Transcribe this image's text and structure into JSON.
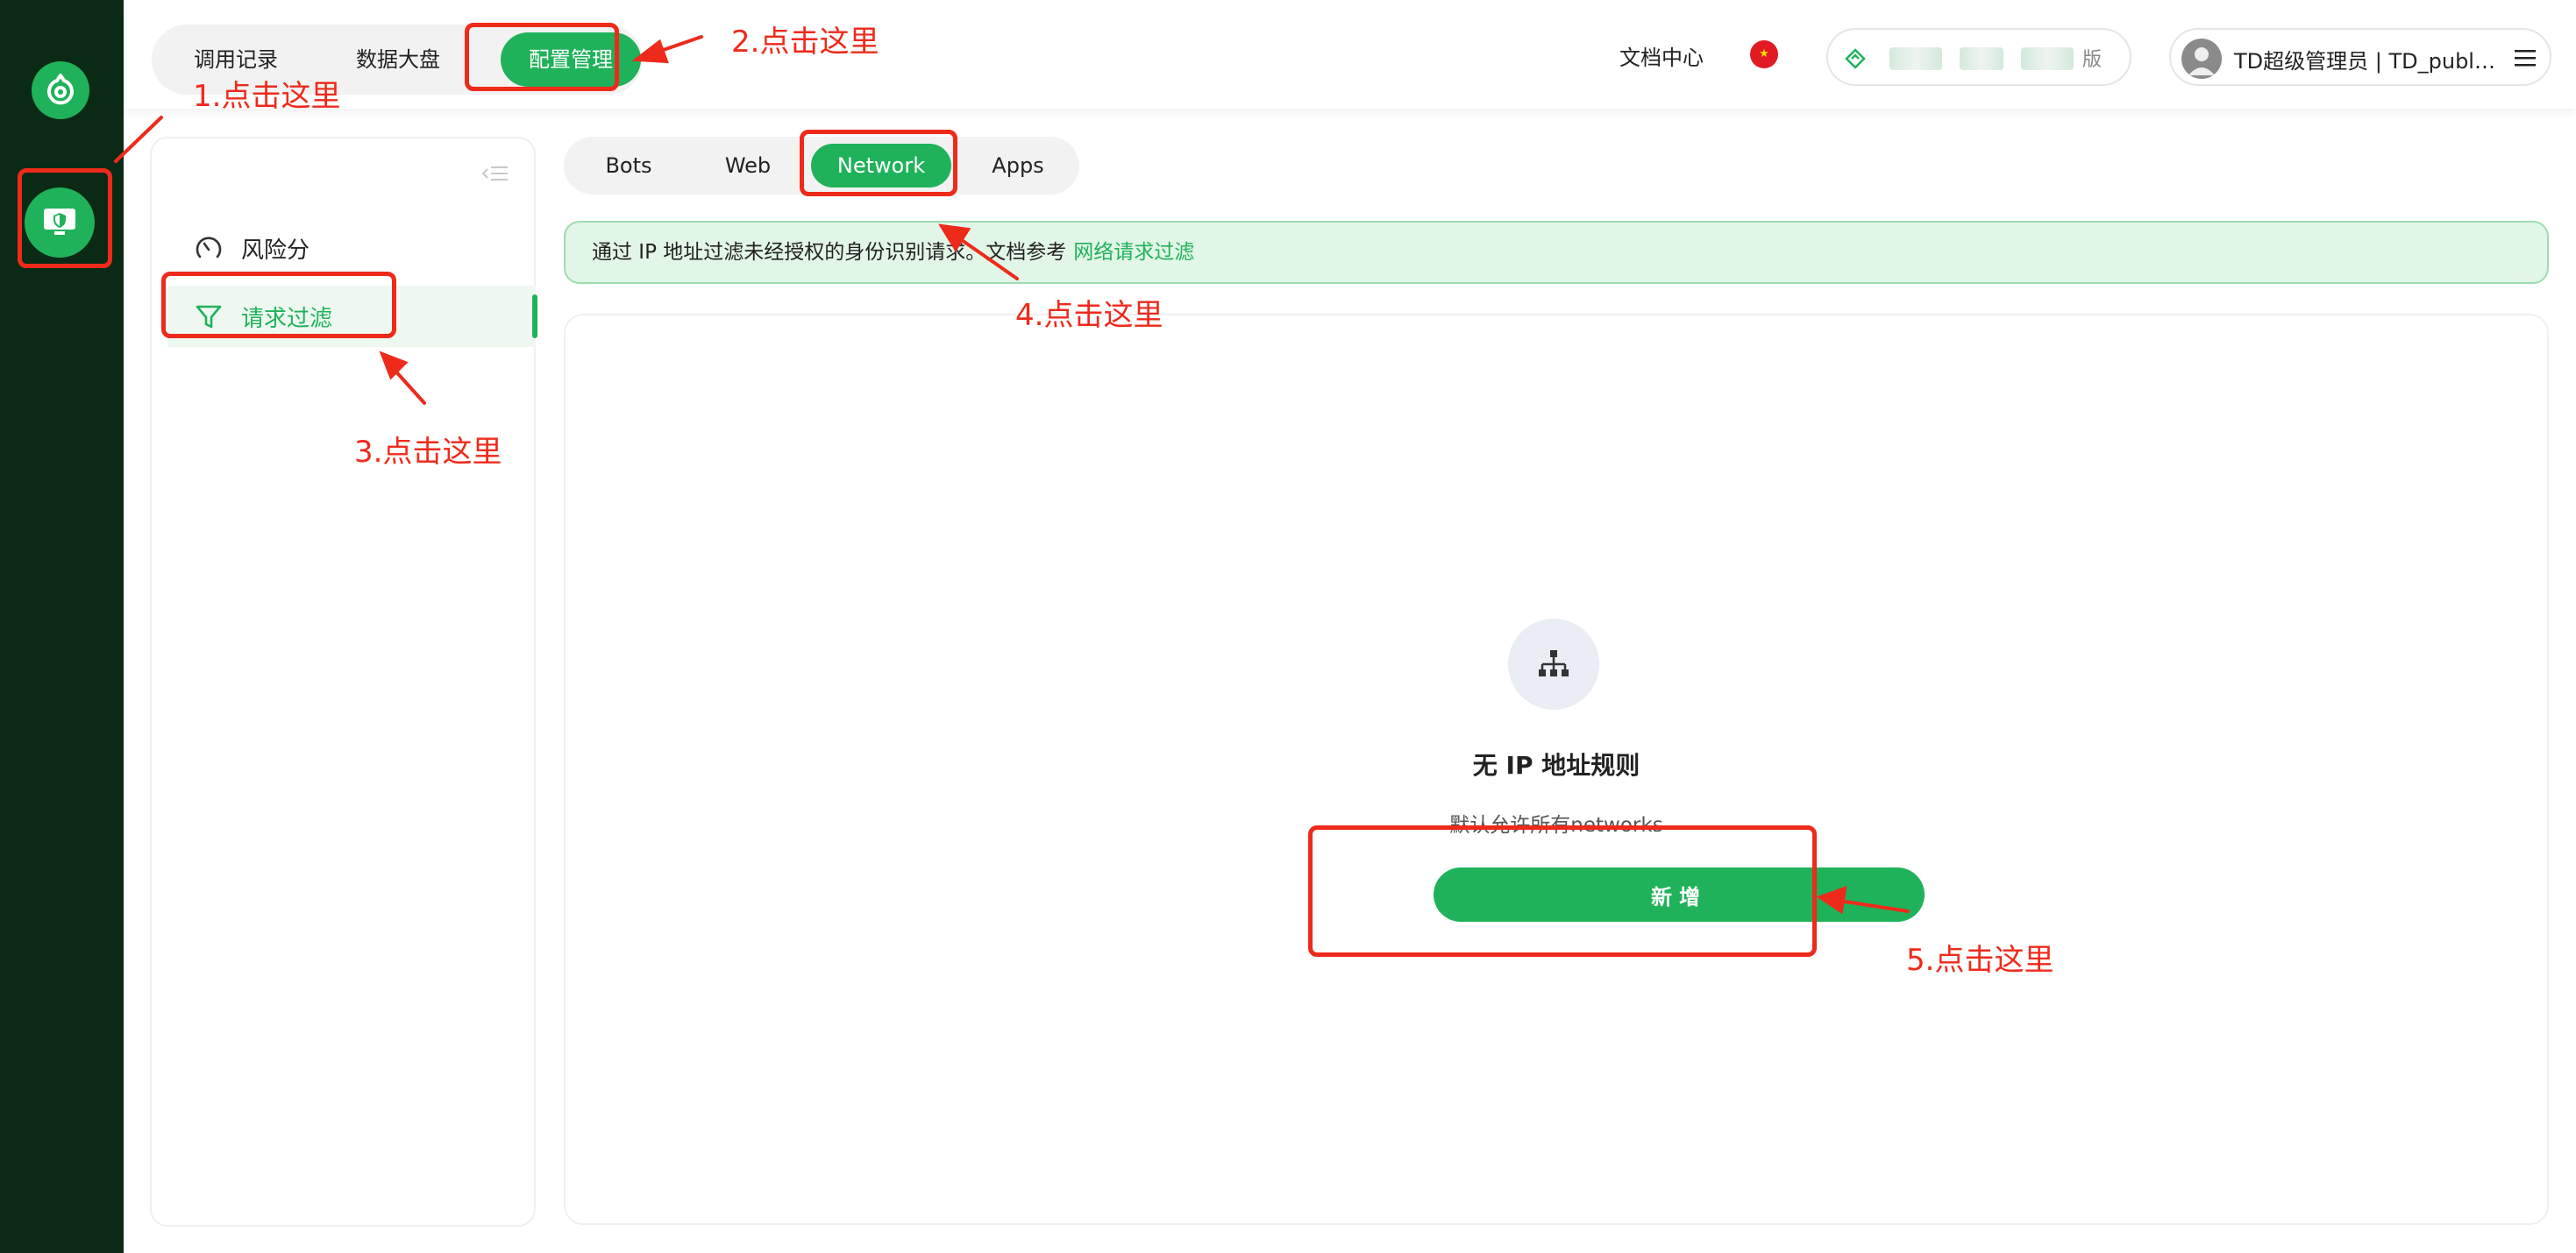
{
  "top_nav": {
    "items": [
      {
        "label": "调用记录",
        "active": false
      },
      {
        "label": "数据大盘",
        "active": false
      },
      {
        "label": "配置管理",
        "active": true
      }
    ]
  },
  "header": {
    "docs_label": "文档中心",
    "language_flag": "cn-flag-icon",
    "plan_suffix": "版",
    "user_label": "TD超级管理员 | TD_publi..."
  },
  "sidebar": {
    "items": [
      {
        "label": "风险分",
        "icon": "gauge-icon",
        "active": false
      },
      {
        "label": "请求过滤",
        "icon": "filter-icon",
        "active": true
      }
    ]
  },
  "subtabs": [
    {
      "label": "Bots",
      "active": false
    },
    {
      "label": "Web",
      "active": false
    },
    {
      "label": "Network",
      "active": true
    },
    {
      "label": "Apps",
      "active": false
    }
  ],
  "notice": {
    "text": "通过 IP 地址过滤未经授权的身份识别请求。文档参考",
    "link": "网络请求过滤"
  },
  "empty_state": {
    "icon": "network-icon",
    "title": "无 IP 地址规则",
    "subtitle": "默认允许所有networks",
    "button": "新增"
  },
  "annotations": [
    {
      "step": 1,
      "label": "1.点击这里"
    },
    {
      "step": 2,
      "label": "2.点击这里"
    },
    {
      "step": 3,
      "label": "3.点击这里"
    },
    {
      "step": 4,
      "label": "4.点击这里"
    },
    {
      "step": 5,
      "label": "5.点击这里"
    }
  ],
  "colors": {
    "accent": "#1fb25a",
    "rail": "#0b2a16",
    "annotation": "#ee2a1b",
    "notice_bg": "#e2f6e7"
  }
}
